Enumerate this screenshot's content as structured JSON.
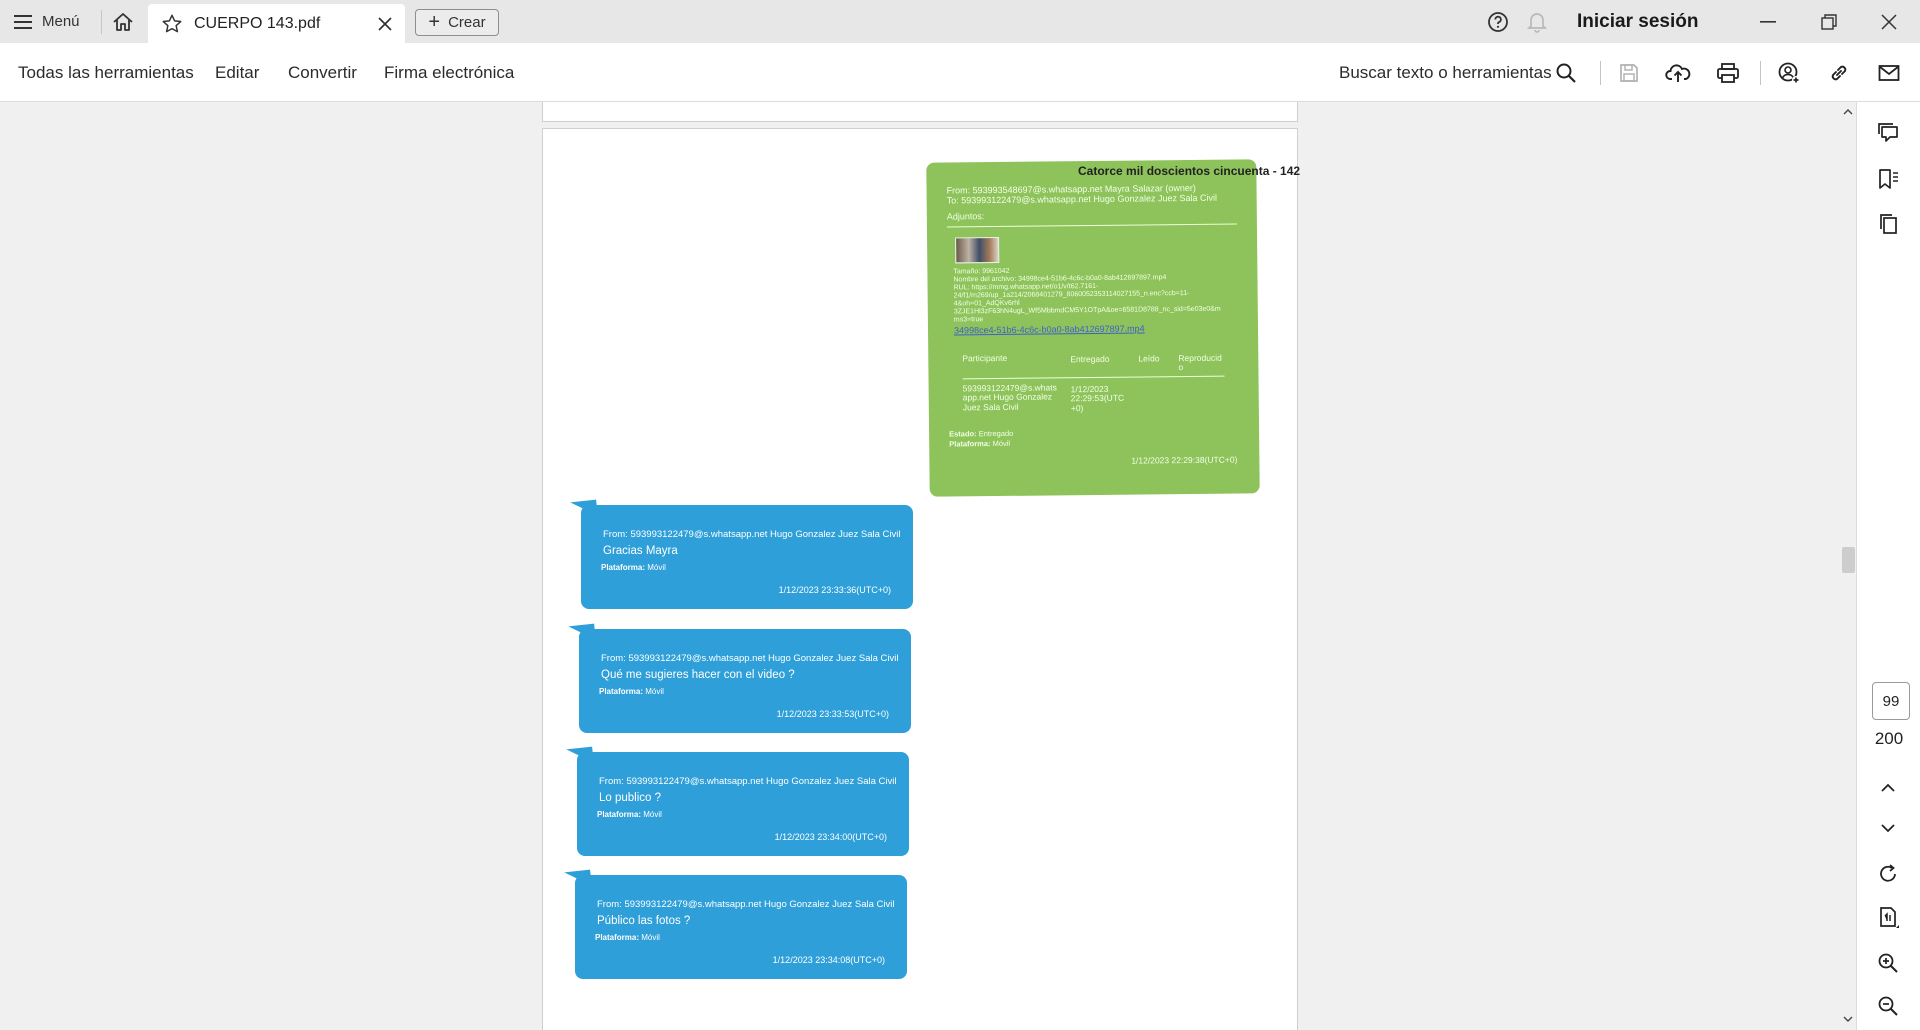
{
  "titlebar": {
    "menu_label": "Menú",
    "tab_title": "CUERPO 143.pdf",
    "create_label": "Crear",
    "signin_label": "Iniciar sesión"
  },
  "toolbar": {
    "links": [
      "Todas las herramientas",
      "Editar",
      "Convertir",
      "Firma electrónica"
    ],
    "search_label": "Buscar texto o herramientas"
  },
  "document": {
    "page_header": "Catorce mil doscientos cincuenta - 142",
    "green_message": {
      "from": "From: 593993548697@s.whatsapp.net Mayra Salazar (owner)",
      "to": "To: 593993122479@s.whatsapp.net Hugo Gonzalez Juez Sala Civil",
      "attachments_label": "Adjuntos:",
      "file_lines": [
        "Tamaño: 9961042",
        "Nombre del archivo: 34998ce4-51b6-4c6c-b0a0-8ab412697897.mp4",
        "RUL: https://mmg.whatsapp.net/o1/v/t62.7161-",
        "24/f1/m269/up_1a214/2068401279_8060052353114027155_n.enc?ccb=11-",
        "4&oh=01_AdQKv6rhl",
        "3ZJE1Hl3zF63hN4ugL_Wf5MbbmdCM5Y1OTpA&oe=6581D8788_nc_sid=5e03e0&m",
        "ms3=true"
      ],
      "file_link": "34998ce4-51b6-4c6c-b0a0-8ab412697897.mp4",
      "table_headers": [
        "Participante",
        "Entregado",
        "Leído",
        "Reproducid o"
      ],
      "table_row": {
        "participant": "593993122479@s.whats app.net Hugo Gonzalez Juez Sala Civil",
        "delivered": "1/12/2023 22:29:53(UTC +0)"
      },
      "status_label": "Estado:",
      "status_value": "Entregado",
      "platform_label": "Plataforma:",
      "platform_value": "Móvil",
      "timestamp": "1/12/2023 22:29:38(UTC+0)"
    },
    "blue_messages": [
      {
        "from": "From: 593993122479@s.whatsapp.net Hugo Gonzalez Juez Sala Civil",
        "text": "Gracias Mayra",
        "platform_label": "Plataforma:",
        "platform_value": "Móvil",
        "timestamp": "1/12/2023 23:33:36(UTC+0)"
      },
      {
        "from": "From: 593993122479@s.whatsapp.net Hugo Gonzalez Juez Sala Civil",
        "text": "Qué me sugieres hacer con el video ?",
        "platform_label": "Plataforma:",
        "platform_value": "Móvil",
        "timestamp": "1/12/2023 23:33:53(UTC+0)"
      },
      {
        "from": "From: 593993122479@s.whatsapp.net Hugo Gonzalez Juez Sala Civil",
        "text": "Lo publico ?",
        "platform_label": "Plataforma:",
        "platform_value": "Móvil",
        "timestamp": "1/12/2023 23:34:00(UTC+0)"
      },
      {
        "from": "From: 593993122479@s.whatsapp.net Hugo Gonzalez Juez Sala Civil",
        "text": "Público las fotos ?",
        "platform_label": "Plataforma:",
        "platform_value": "Móvil",
        "timestamp": "1/12/2023 23:34:08(UTC+0)"
      }
    ]
  },
  "navigation": {
    "current_page": "99",
    "total_pages": "200"
  },
  "colors": {
    "accent": "#1473e6",
    "green_bubble": "#8dc35a",
    "blue_bubble": "#2e9fd8"
  },
  "icons": {
    "left_tools": [
      "select-arrow-icon",
      "add-comment-icon",
      "highlight-pen-icon",
      "lasso-draw-icon",
      "text-select-icon",
      "sign-pen-icon"
    ],
    "right_rail": [
      "comments-icon",
      "bookmarks-icon",
      "pages-icon",
      "rotate-icon",
      "page-fit-icon",
      "zoom-in-icon",
      "zoom-out-icon"
    ]
  }
}
